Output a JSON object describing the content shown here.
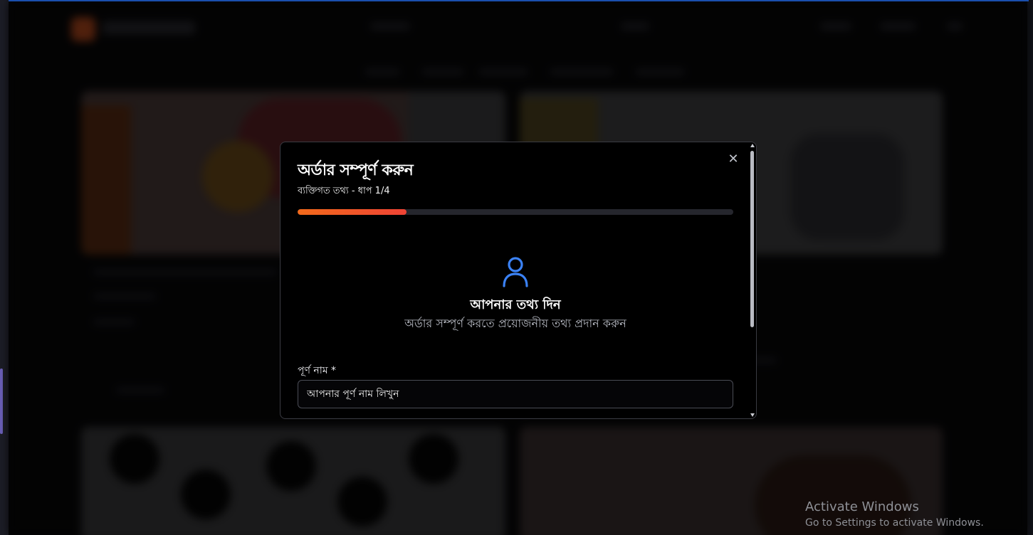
{
  "modal": {
    "title": "অর্ডার সম্পূর্ণ করুন",
    "step_text": "ব্যক্তিগত তথ্য - ধাপ 1/4",
    "progress_fraction": 0.25,
    "close_label": "✕",
    "section": {
      "icon": "user-icon",
      "title": "আপনার তথ্য দিন",
      "subtitle": "অর্ডার সম্পূর্ণ করতে প্রয়োজনীয় তথ্য প্রদান করুন"
    },
    "fields": {
      "full_name": {
        "label": "পূর্ণ নাম *",
        "placeholder": "আপনার পূর্ণ নাম লিখুন",
        "value": ""
      }
    }
  },
  "colors": {
    "accent_start": "#f26a1b",
    "accent_end": "#ef4335",
    "icon_blue": "#3b82f6",
    "modal_bg": "#000000"
  },
  "watermark": {
    "title": "Activate Windows",
    "subtitle": "Go to Settings to activate Windows."
  }
}
